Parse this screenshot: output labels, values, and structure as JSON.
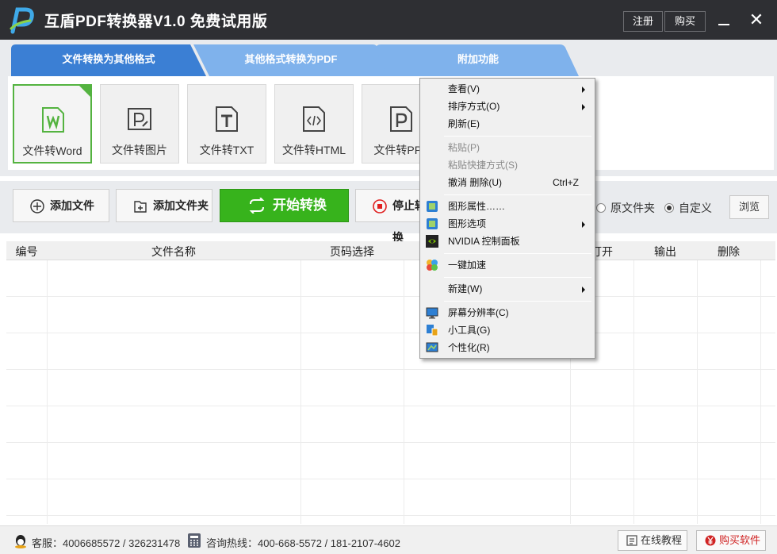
{
  "app": {
    "title": "互盾PDF转换器V1.0 免费试用版",
    "register_label": "注册",
    "buy_label": "购买",
    "close_glyph": "✕"
  },
  "tabs": [
    {
      "label": "文件转换为其他格式",
      "active": true
    },
    {
      "label": "其他格式转换为PDF",
      "active": false
    },
    {
      "label": "附加功能",
      "active": false
    }
  ],
  "tools": [
    {
      "label": "文件转Word",
      "icon": "word-icon",
      "active": true
    },
    {
      "label": "文件转图片",
      "icon": "image-icon",
      "active": false
    },
    {
      "label": "文件转TXT",
      "icon": "txt-icon",
      "active": false
    },
    {
      "label": "文件转HTML",
      "icon": "html-icon",
      "active": false
    },
    {
      "label": "文件转PPT",
      "icon": "ppt-icon",
      "active": false
    }
  ],
  "actions": {
    "add_file": "添加文件",
    "add_folder": "添加文件夹",
    "start": "开始转换",
    "stop": "停止转换"
  },
  "output": {
    "source_folder": "原文件夹",
    "custom": "自定义",
    "selected": "custom",
    "browse": "浏览"
  },
  "table": {
    "columns": [
      "编号",
      "文件名称",
      "页码选择",
      "",
      "打开",
      "输出",
      "删除"
    ]
  },
  "status": {
    "service": "客服：4006685572 / 326231478",
    "hotline": "咨询热线：400-668-5572 / 181-2107-4602",
    "tutorial": "在线教程",
    "buy_software": "购买软件"
  },
  "context_menu": {
    "items": [
      {
        "label": "查看(V)",
        "submenu": true
      },
      {
        "label": "排序方式(O)",
        "submenu": true
      },
      {
        "label": "刷新(E)"
      },
      {
        "label": "粘贴(P)",
        "disabled": true
      },
      {
        "label": "粘贴快捷方式(S)",
        "disabled": true
      },
      {
        "label": "撤消 删除(U)",
        "shortcut": "Ctrl+Z"
      },
      {
        "label": "图形属性……",
        "icon": "graphics-properties-icon"
      },
      {
        "label": "图形选项",
        "icon": "graphics-options-icon",
        "submenu": true
      },
      {
        "label": "NVIDIA 控制面板",
        "icon": "nvidia-icon"
      },
      {
        "label": "一键加速",
        "icon": "speedup-icon"
      },
      {
        "label": "新建(W)",
        "submenu": true
      },
      {
        "label": "屏幕分辨率(C)",
        "icon": "screen-resolution-icon"
      },
      {
        "label": "小工具(G)",
        "icon": "gadgets-icon"
      },
      {
        "label": "个性化(R)",
        "icon": "personalize-icon"
      }
    ]
  },
  "colors": {
    "titlebar": "#2e2f33",
    "tab_active": "#3b7fd4",
    "tab_inactive": "#7fb2ec",
    "accent_green": "#37b31c",
    "stop_red": "#e02020"
  }
}
